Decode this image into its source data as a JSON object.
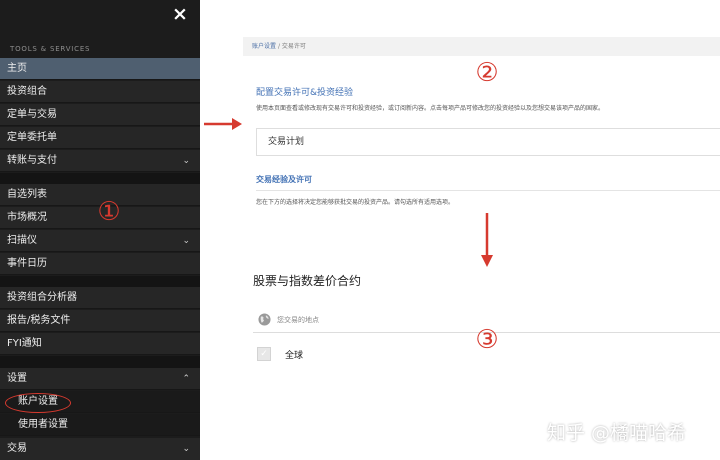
{
  "sidebar": {
    "close_icon": "×",
    "section_heading": "TOOLS & SERVICES",
    "groups": [
      [
        {
          "label": "主页",
          "active": true
        },
        {
          "label": "投资组合"
        },
        {
          "label": "定单与交易"
        },
        {
          "label": "定单委托单"
        },
        {
          "label": "转账与支付",
          "chevron": "down"
        }
      ],
      [
        {
          "label": "自选列表"
        },
        {
          "label": "市场概况"
        },
        {
          "label": "扫描仪",
          "chevron": "down"
        },
        {
          "label": "事件日历"
        }
      ],
      [
        {
          "label": "投资组合分析器"
        },
        {
          "label": "报告/税务文件"
        },
        {
          "label": "FYI通知"
        }
      ],
      [
        {
          "label": "设置",
          "chevron": "up"
        },
        {
          "label": "账户设置",
          "sub": true
        },
        {
          "label": "使用者设置",
          "sub": true
        },
        {
          "label": "交易",
          "chevron": "down"
        }
      ]
    ]
  },
  "panel_a": {
    "breadcrumb_link": "账户设置",
    "breadcrumb_sep": "/",
    "breadcrumb_current": "交易许可",
    "title": "配置交易许可&投资经验",
    "description": "使用本页面查看或修改现有交易许可和投资经验，或订阅新内容。点击每项产品可修改您的投资经验以及您想交易该项产品的国家。",
    "plan_button": "交易计划",
    "experience_title": "交易经验及许可",
    "experience_desc": "您在下方的选择将决定您能够获批交易的投资产品。请勾选所有适用选项。"
  },
  "panel_b": {
    "title": "股票与指数差价合约",
    "location_label": "您交易的地点",
    "global_label": "全球",
    "globe_icon": "globe-icon",
    "check_icon": "✓"
  },
  "annotations": {
    "one": "①",
    "two": "②",
    "three": "③",
    "accent_color": "#d63a2f"
  },
  "watermark": "知乎 @橘喵哈希"
}
